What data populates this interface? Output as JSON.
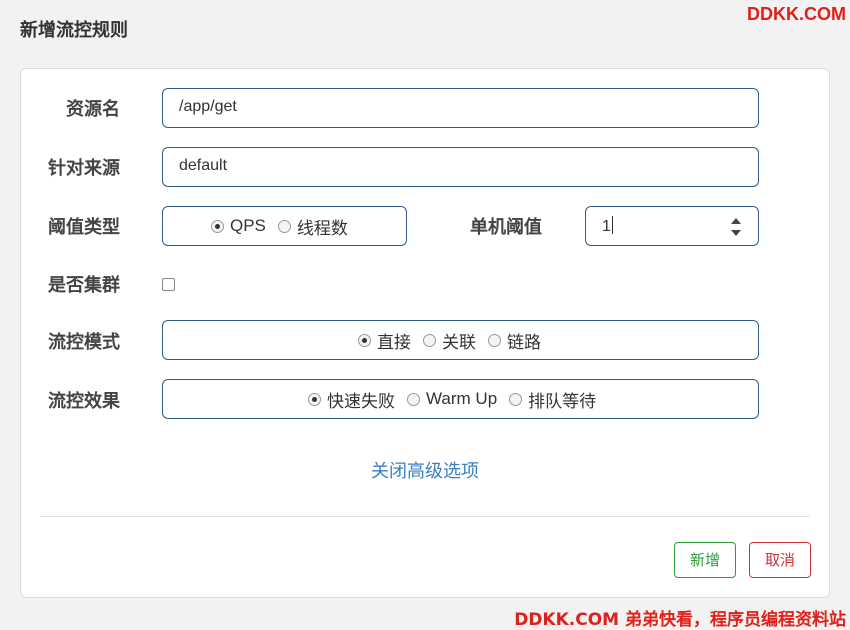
{
  "dialog": {
    "title": "新增流控规则"
  },
  "watermark": {
    "top": "DDKK.COM",
    "bottom": "DDKK.COM 弟弟快看，程序员编程资料站"
  },
  "form": {
    "resource_label": "资源名",
    "resource_value": "/app/get",
    "source_label": "针对来源",
    "source_value": "default",
    "threshold_type_label": "阈值类型",
    "threshold_type_options": [
      "QPS",
      "线程数"
    ],
    "threshold_type_selected": "QPS",
    "single_threshold_label": "单机阈值",
    "single_threshold_value": "1",
    "cluster_label": "是否集群",
    "cluster_checked": false,
    "flow_mode_label": "流控模式",
    "flow_mode_options": [
      "直接",
      "关联",
      "链路"
    ],
    "flow_mode_selected": "直接",
    "flow_effect_label": "流控效果",
    "flow_effect_options": [
      "快速失败",
      "Warm Up",
      "排队等待"
    ],
    "flow_effect_selected": "快速失败",
    "advanced_toggle": "关闭高级选项"
  },
  "footer": {
    "add_label": "新增",
    "cancel_label": "取消"
  },
  "colors": {
    "field_border": "#2f5d8a",
    "link": "#3a7fc1",
    "add": "#2e9b3a",
    "cancel": "#d0303a",
    "watermark": "#e0201a"
  }
}
